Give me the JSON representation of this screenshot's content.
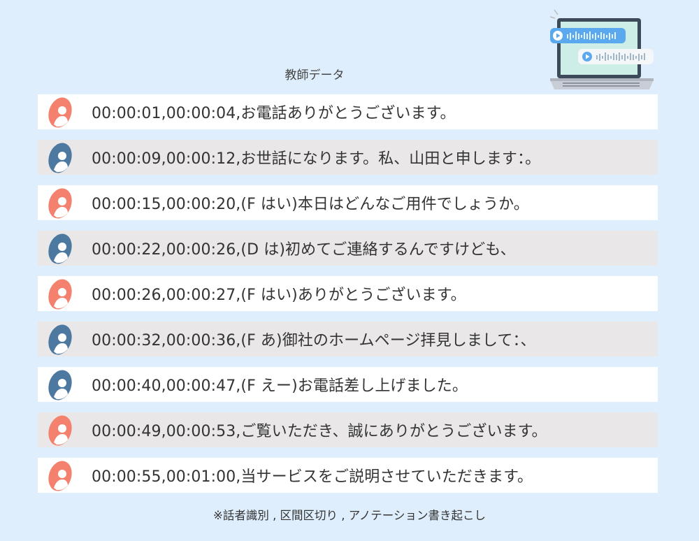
{
  "title": "教師データ",
  "colors": {
    "speaker_a": "#f4806e",
    "speaker_b": "#4d79a0",
    "bg": "#dfeefc"
  },
  "rows": [
    {
      "speaker": "a",
      "text": "00:00:01,00:00:04,お電話ありがとうございます。"
    },
    {
      "speaker": "b",
      "text": "00:00:09,00:00:12,お世話になります。私、山田と申します：。"
    },
    {
      "speaker": "a",
      "text": "00:00:15,00:00:20,(F はい)本日はどんなご用件でしょうか。"
    },
    {
      "speaker": "b",
      "text": "00:00:22,00:00:26,(D は)初めてご連絡するんですけども、"
    },
    {
      "speaker": "a",
      "text": "00:00:26,00:00:27,(F はい)ありがとうございます。"
    },
    {
      "speaker": "b",
      "text": "00:00:32,00:00:36,(F あ)御社のホームページ拝見しまして：、"
    },
    {
      "speaker": "b",
      "text": "00:00:40,00:00:47,(F えー)お電話差し上げました。"
    },
    {
      "speaker": "a",
      "text": "00:00:49,00:00:53,ご覧いただき、誠にありがとうございます。"
    },
    {
      "speaker": "a",
      "text": "00:00:55,00:01:00,当サービスをご説明させていただきます。"
    }
  ],
  "caption": "※話者識別 , 区間区切り , アノテーション書き起こし",
  "illustration": {
    "icon": "laptop-audio-icon"
  }
}
